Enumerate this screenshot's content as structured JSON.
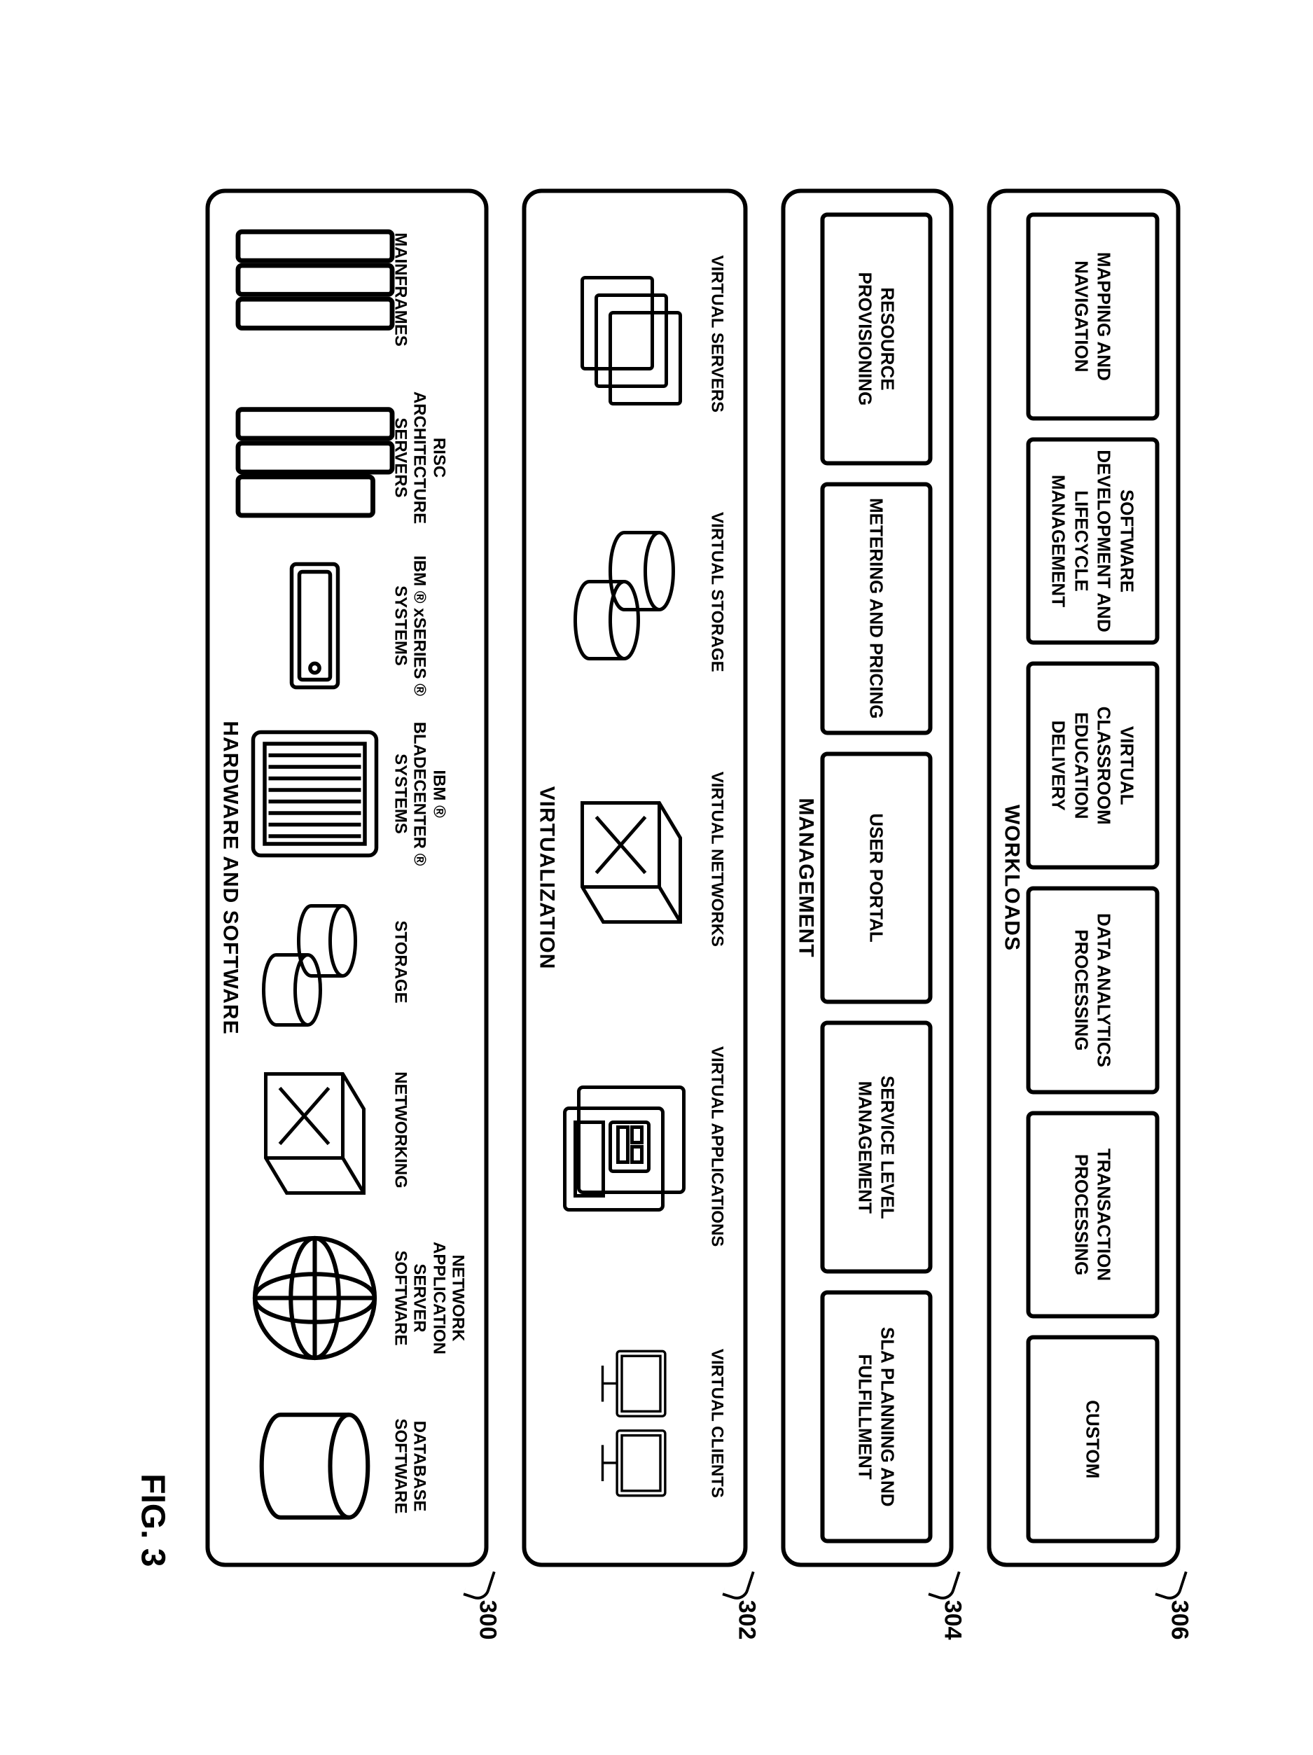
{
  "figure_label": "FIG. 3",
  "layers": {
    "workloads": {
      "title": "WORKLOADS",
      "ref": "306",
      "boxes": [
        "MAPPING AND NAVIGATION",
        "SOFTWARE DEVELOPMENT AND LIFECYCLE MANAGEMENT",
        "VIRTUAL CLASSROOM EDUCATION DELIVERY",
        "DATA ANALYTICS PROCESSING",
        "TRANSACTION PROCESSING",
        "CUSTOM"
      ]
    },
    "management": {
      "title": "MANAGEMENT",
      "ref": "304",
      "boxes": [
        "RESOURCE PROVISIONING",
        "METERING AND PRICING",
        "USER PORTAL",
        "SERVICE LEVEL MANAGEMENT",
        "SLA PLANNING AND FULFILLMENT"
      ]
    },
    "virtualization": {
      "title": "VIRTUALIZATION",
      "ref": "302",
      "items": [
        "VIRTUAL SERVERS",
        "VIRTUAL STORAGE",
        "VIRTUAL NETWORKS",
        "VIRTUAL APPLICATIONS",
        "VIRTUAL CLIENTS"
      ]
    },
    "hardware": {
      "title": "HARDWARE AND SOFTWARE",
      "ref": "300",
      "items": [
        "MAINFRAMES",
        "RISC ARCHITECTURE SERVERS",
        "IBM ® xSERIES ® SYSTEMS",
        "IBM ® BLADECENTER ® SYSTEMS",
        "STORAGE",
        "NETWORKING",
        "NETWORK APPLICATION SERVER SOFTWARE",
        "DATABASE SOFTWARE"
      ]
    }
  }
}
